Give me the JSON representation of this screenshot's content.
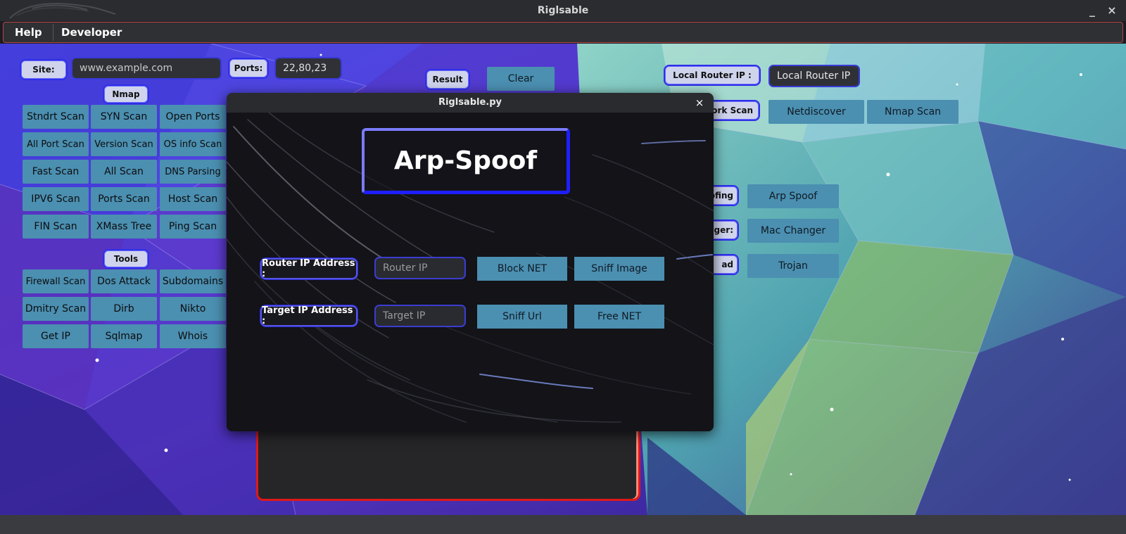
{
  "window": {
    "title": "Riglsable"
  },
  "menu": {
    "help": "Help",
    "developer": "Developer"
  },
  "left": {
    "site_label": "Site:",
    "site_placeholder": "www.example.com",
    "ports_label": "Ports:",
    "ports_value": "22,80,23",
    "nmap_header": "Nmap",
    "nmap_buttons": [
      [
        "Stndrt Scan",
        "SYN Scan",
        "Open Ports"
      ],
      [
        "All Port Scan",
        "Version Scan",
        "OS info Scan"
      ],
      [
        "Fast Scan",
        "All Scan",
        "DNS Parsing"
      ],
      [
        "IPV6 Scan",
        "Ports Scan",
        "Host Scan"
      ],
      [
        "FIN Scan",
        "XMass Tree",
        "Ping Scan"
      ]
    ],
    "tools_header": "Tools",
    "tools_buttons": [
      [
        "Firewall Scan",
        "Dos Attack",
        "Subdomains"
      ],
      [
        "Dmitry Scan",
        "Dirb",
        "Nikto"
      ],
      [
        "Get IP",
        "Sqlmap",
        "Whois"
      ]
    ]
  },
  "center": {
    "result_label": "Result",
    "clear_label": "Clear"
  },
  "right": {
    "local_router_label": "Local Router IP :",
    "local_router_placeholder": "Local Router IP",
    "network_scan_label": "work Scan",
    "netdiscover": "Netdiscover",
    "nmap_scan": "Nmap Scan",
    "spoofing_label": "ofing",
    "arp_spoof": "Arp Spoof",
    "changer_label": "nger:",
    "mac_changer": "Mac Changer",
    "payload_label": "ad",
    "trojan": "Trojan"
  },
  "dialog": {
    "title": "Riglsable.py",
    "close": "×",
    "heading": "Arp-Spoof",
    "router_label": "Router IP Address :",
    "router_placeholder": "Router IP",
    "target_label": "Target IP Address :",
    "target_placeholder": "Target IP",
    "block_net": "Block NET",
    "sniff_image": "Sniff Image",
    "sniff_url": "Sniff Url",
    "free_net": "Free NET"
  },
  "window_controls": {
    "minimize": "_",
    "close": "×"
  },
  "colors": {
    "button": "#4b8fb1",
    "accent_blue": "#2f2fe8",
    "result_border": "#e01818"
  }
}
